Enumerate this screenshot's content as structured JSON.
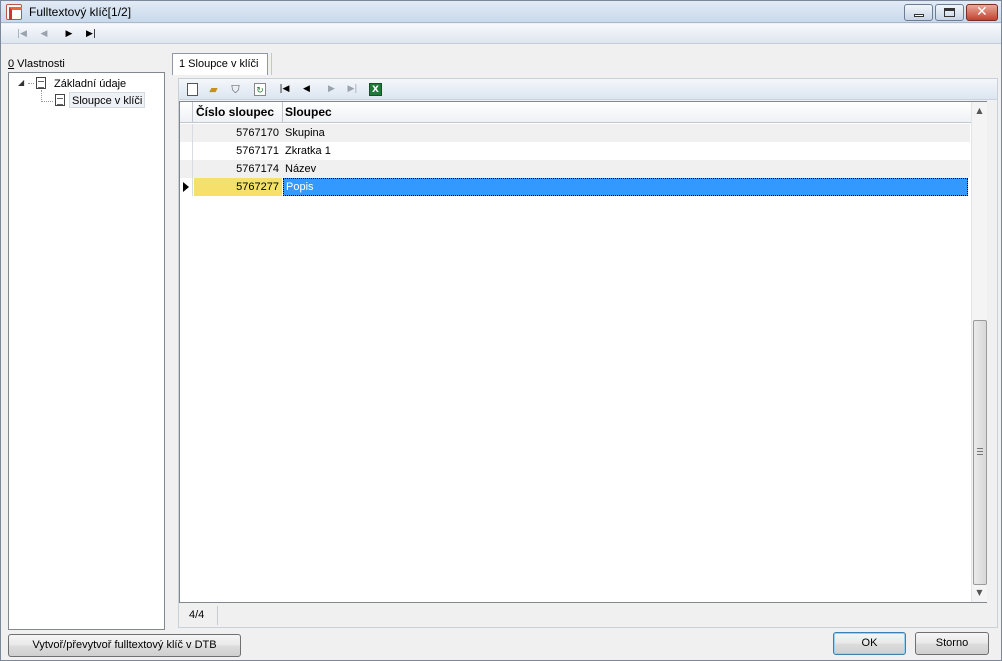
{
  "window": {
    "title": "Fulltextový klíč[1/2]"
  },
  "nav": {
    "first": "|◀",
    "prev": "◀",
    "next": "▶",
    "last": "▶|"
  },
  "left_panel": {
    "tab_hotkey": "0",
    "tab_label": " Vlastnosti",
    "tree": [
      {
        "label": "Základní údaje",
        "expanded": true
      },
      {
        "label": "Sloupce v klíči",
        "selected": true
      }
    ]
  },
  "right_panel": {
    "tab_label": "1 Sloupce v klíči",
    "toolbar": {
      "icons": [
        "new-record-icon",
        "open-folder-icon",
        "filter-icon",
        "refresh-icon",
        "first-record-icon",
        "prev-record-icon",
        "next-record-icon",
        "last-record-icon",
        "excel-export-icon"
      ]
    },
    "grid": {
      "columns": [
        "Číslo sloupec",
        "Sloupec"
      ],
      "rows": [
        {
          "cislo": "5767170",
          "sloupec": "Skupina"
        },
        {
          "cislo": "5767171",
          "sloupec": "Zkratka 1"
        },
        {
          "cislo": "5767174",
          "sloupec": "Název"
        },
        {
          "cislo": "5767277",
          "sloupec": "Popis",
          "selected": true
        }
      ]
    },
    "status": {
      "count": "4/4"
    }
  },
  "buttons": {
    "create": "Vytvoř/převytvoř fulltextový klíč v DTB",
    "ok": "OK",
    "cancel": "Storno"
  },
  "colors": {
    "selection": "#3399ff",
    "current_cell": "#f4e06a"
  }
}
